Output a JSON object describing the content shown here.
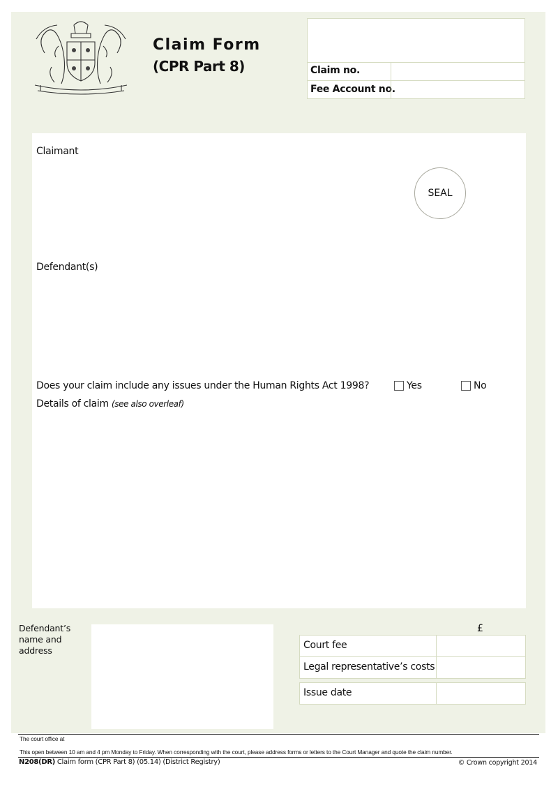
{
  "header": {
    "crest": "royal-coat-of-arms",
    "title": "Claim Form",
    "subtitle": "(CPR Part 8)"
  },
  "reference_box": {
    "claim_no_label": "Claim no.",
    "claim_no_value": "",
    "fee_account_label": "Fee Account no.",
    "fee_account_value": ""
  },
  "main": {
    "claimant_label": "Claimant",
    "seal_label": "SEAL",
    "defendants_label": "Defendant(s)",
    "human_rights_question": "Does your claim include any issues under the Human Rights Act 1998?",
    "yes_label": "Yes",
    "no_label": "No",
    "details_label": "Details of claim",
    "details_hint": "(see also overleaf)"
  },
  "defendant_address": {
    "label_line1": "Defendant’s",
    "label_line2": "name and",
    "label_line3": "address"
  },
  "fees": {
    "currency_symbol": "£",
    "court_fee_label": "Court fee",
    "legal_costs_label": "Legal representative’s costs",
    "issue_date_label": "Issue date"
  },
  "footer": {
    "court_office": "The court office  at",
    "opening_notice": "This open between 10 am and 4 pm Monday to Friday. When corresponding with the court, please address forms or letters to the Court Manager and quote the claim number.",
    "form_code": "N208(DR)",
    "form_name": " Claim form (CPR Part 8) (05.14) (District Registry)",
    "copyright": "© Crown copyright 2014"
  },
  "colors": {
    "panel_background": "#eff2e6",
    "field_border": "#d6dcc2"
  }
}
